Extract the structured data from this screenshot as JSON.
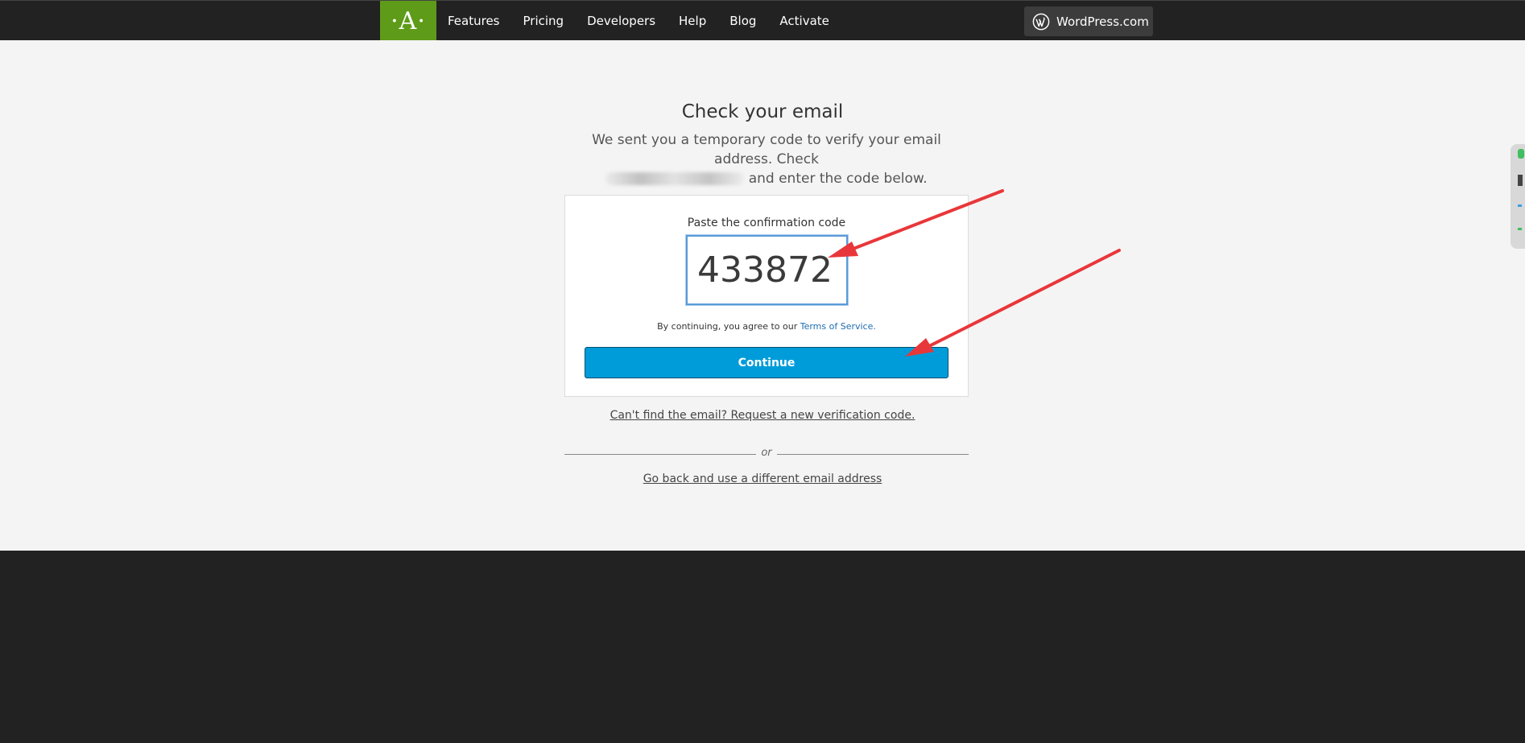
{
  "nav": {
    "logo_text": "·A·",
    "items": [
      "Features",
      "Pricing",
      "Developers",
      "Help",
      "Blog",
      "Activate"
    ],
    "wordpress_label": "WordPress.com"
  },
  "verify": {
    "title": "Check your email",
    "subtitle_line1": "We sent you a temporary code to verify your email address. Check",
    "subtitle_line2_suffix": " and enter the code below.",
    "code_label": "Paste the confirmation code",
    "code_value": "433872",
    "tos_prefix": "By continuing, you agree to our ",
    "tos_link": "Terms of Service.",
    "continue_label": "Continue",
    "resend_link": "Can't find the email? Request a new verification code.",
    "or_text": "or",
    "back_link": "Go back and use a different email address"
  },
  "colors": {
    "nav_bg": "#222222",
    "logo_green": "#5e9b19",
    "page_bg": "#f4f4f4",
    "button_blue": "#009cd9",
    "arrow_red": "#e8373a"
  }
}
